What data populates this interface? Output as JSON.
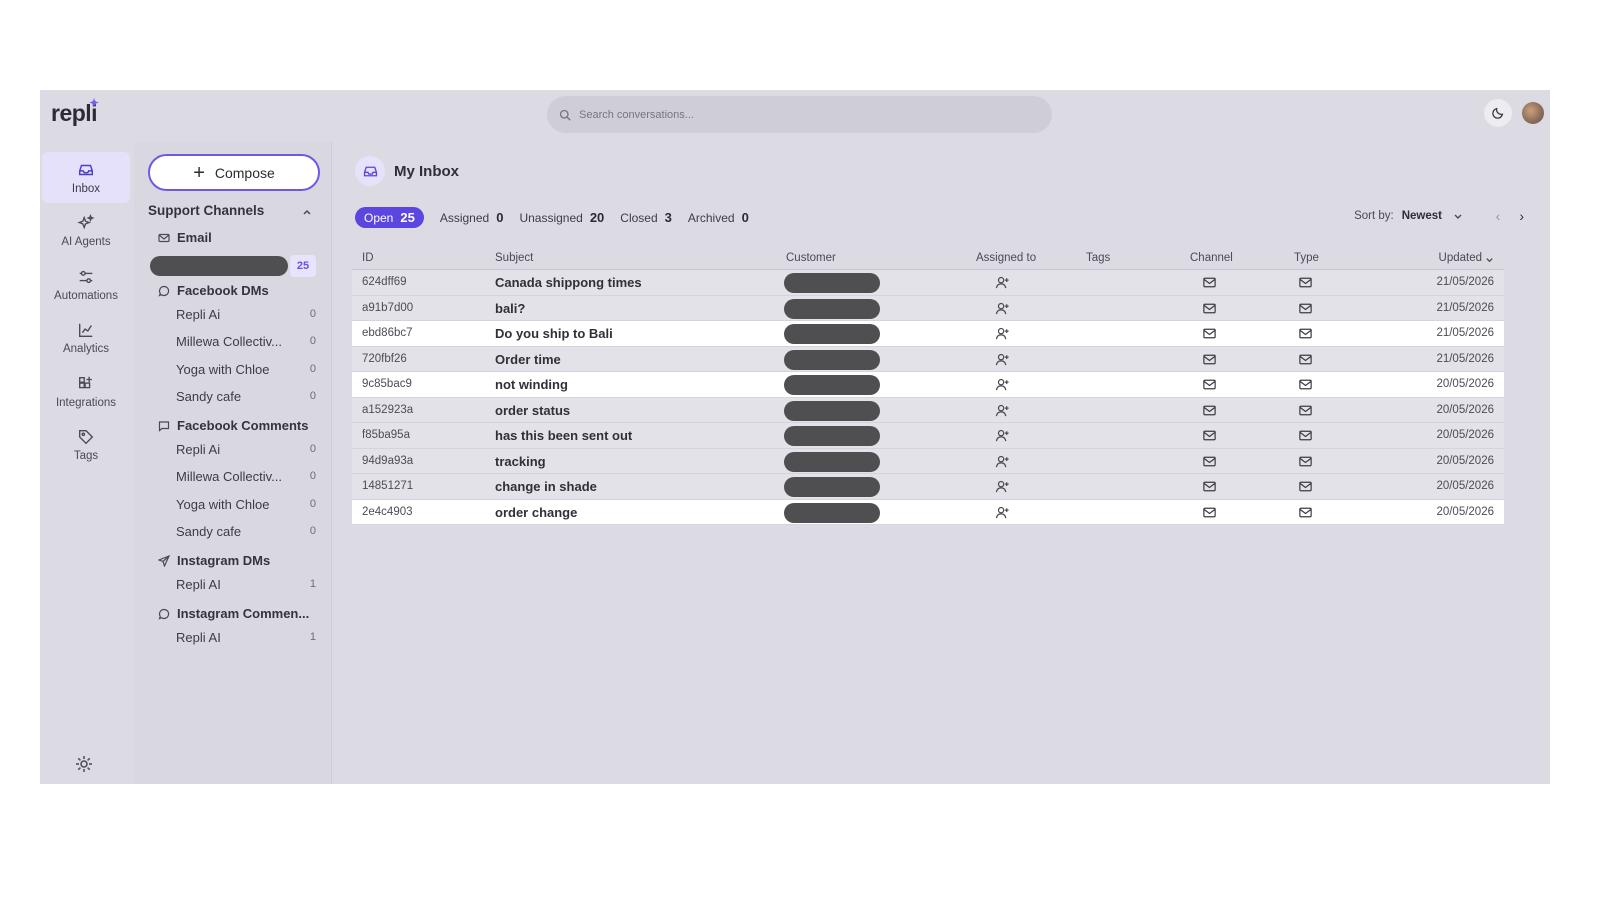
{
  "app": {
    "logo": "repli"
  },
  "search": {
    "placeholder": "Search conversations..."
  },
  "nav": {
    "items": [
      {
        "label": "Inbox",
        "icon": "inbox-icon",
        "active": true
      },
      {
        "label": "AI Agents",
        "icon": "sparkles-icon"
      },
      {
        "label": "Automations",
        "icon": "sliders-icon"
      },
      {
        "label": "Analytics",
        "icon": "chart-line-icon"
      },
      {
        "label": "Integrations",
        "icon": "grid-plus-icon"
      },
      {
        "label": "Tags",
        "icon": "tag-icon"
      }
    ]
  },
  "channels": {
    "compose_label": "Compose",
    "section_title": "Support Channels",
    "email": {
      "title": "Email",
      "count": "25"
    },
    "facebook_dms": {
      "title": "Facebook DMs",
      "items": [
        {
          "name": "Repli Ai",
          "count": "0"
        },
        {
          "name": "Millewa Collectiv...",
          "count": "0"
        },
        {
          "name": "Yoga with Chloe",
          "count": "0"
        },
        {
          "name": "Sandy cafe",
          "count": "0"
        }
      ]
    },
    "facebook_comments": {
      "title": "Facebook Comments",
      "items": [
        {
          "name": "Repli Ai",
          "count": "0"
        },
        {
          "name": "Millewa Collectiv...",
          "count": "0"
        },
        {
          "name": "Yoga with Chloe",
          "count": "0"
        },
        {
          "name": "Sandy cafe",
          "count": "0"
        }
      ]
    },
    "instagram_dms": {
      "title": "Instagram DMs",
      "items": [
        {
          "name": "Repli AI",
          "count": "1"
        }
      ]
    },
    "instagram_comments": {
      "title": "Instagram Commen...",
      "items": [
        {
          "name": "Repli AI",
          "count": "1"
        }
      ]
    }
  },
  "inbox": {
    "title": "My Inbox",
    "filters": [
      {
        "label": "Open",
        "count": "25",
        "active": true
      },
      {
        "label": "Assigned",
        "count": "0"
      },
      {
        "label": "Unassigned",
        "count": "20"
      },
      {
        "label": "Closed",
        "count": "3"
      },
      {
        "label": "Archived",
        "count": "0"
      }
    ],
    "sort_label": "Sort by:",
    "sort_value": "Newest",
    "columns": {
      "id": "ID",
      "subject": "Subject",
      "customer": "Customer",
      "assigned": "Assigned to",
      "tags": "Tags",
      "channel": "Channel",
      "type": "Type",
      "updated": "Updated"
    },
    "rows": [
      {
        "id": "624dff69",
        "subject": "Canada shippong times",
        "updated": "21/05/2026",
        "unread": false
      },
      {
        "id": "a91b7d00",
        "subject": "bali?",
        "updated": "21/05/2026",
        "unread": false
      },
      {
        "id": "ebd86bc7",
        "subject": "Do you ship to Bali",
        "updated": "21/05/2026",
        "unread": true
      },
      {
        "id": "720fbf26",
        "subject": "Order time",
        "updated": "21/05/2026",
        "unread": false
      },
      {
        "id": "9c85bac9",
        "subject": "not winding",
        "updated": "20/05/2026",
        "unread": true
      },
      {
        "id": "a152923a",
        "subject": "order status",
        "updated": "20/05/2026",
        "unread": false
      },
      {
        "id": "f85ba95a",
        "subject": "has this been sent out",
        "updated": "20/05/2026",
        "unread": false
      },
      {
        "id": "94d9a93a",
        "subject": "tracking",
        "updated": "20/05/2026",
        "unread": false
      },
      {
        "id": "14851271",
        "subject": "change in shade",
        "updated": "20/05/2026",
        "unread": false
      },
      {
        "id": "2e4c4903",
        "subject": "order change",
        "updated": "20/05/2026",
        "unread": true
      }
    ]
  },
  "colors": {
    "accent": "#5b46e0",
    "redaction": "#4f4f52"
  }
}
